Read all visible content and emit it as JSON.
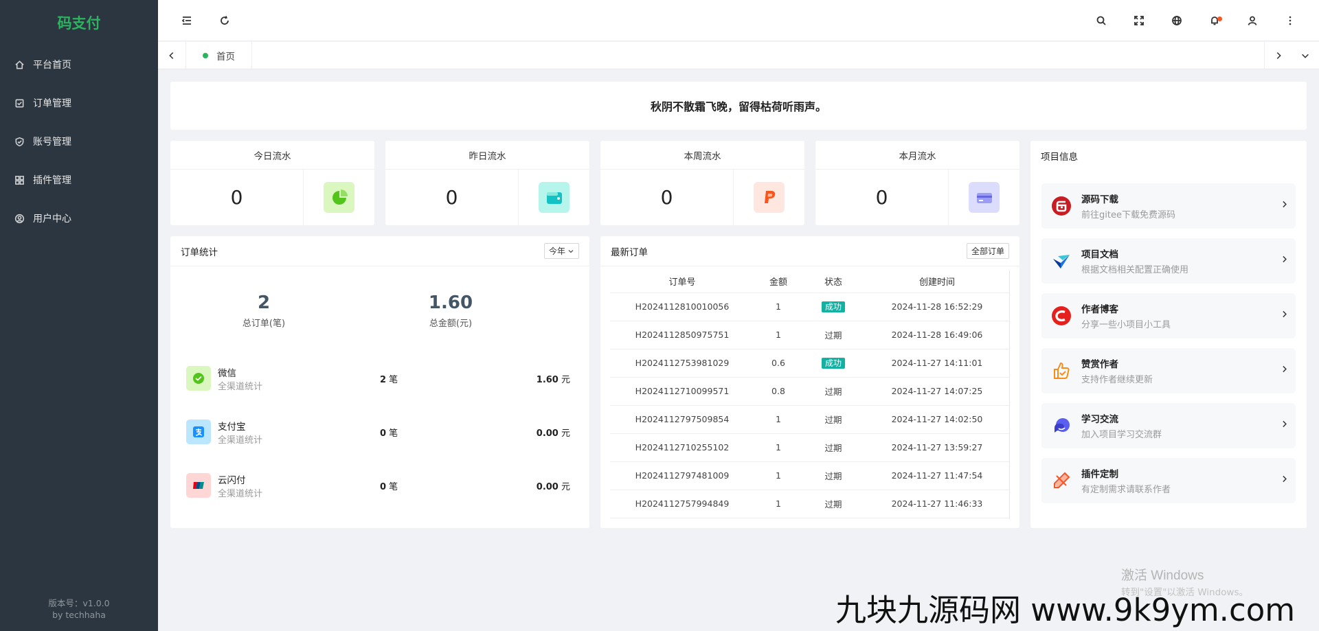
{
  "sidebar": {
    "brand": "码支付",
    "items": [
      {
        "label": "平台首页",
        "icon": "home-icon"
      },
      {
        "label": "订单管理",
        "icon": "checklist-icon"
      },
      {
        "label": "账号管理",
        "icon": "shield-check-icon"
      },
      {
        "label": "插件管理",
        "icon": "grid-icon"
      },
      {
        "label": "用户中心",
        "icon": "user-circle-icon"
      }
    ],
    "version": "版本号：v1.0.0",
    "author": "by techhaha"
  },
  "topbar": {
    "icons": [
      "menu-fold-icon",
      "refresh-icon",
      "search-icon",
      "fullscreen-icon",
      "globe-icon",
      "bell-icon",
      "user-icon",
      "more-icon"
    ]
  },
  "tabs": {
    "home_label": "首页"
  },
  "quote": "秋阴不散霜飞晚，留得枯荷听雨声。",
  "stats": [
    {
      "title": "今日流水",
      "value": "0",
      "icon": "pie-chart-icon",
      "color": "#52c41a"
    },
    {
      "title": "昨日流水",
      "value": "0",
      "icon": "wallet-icon",
      "color": "#13c2c2"
    },
    {
      "title": "本周流水",
      "value": "0",
      "icon": "paypal-icon",
      "color": "#fa541c"
    },
    {
      "title": "本月流水",
      "value": "0",
      "icon": "card-icon",
      "color": "#7c7ff0"
    }
  ],
  "order_stats": {
    "title": "订单统计",
    "range": "今年",
    "total_orders": "2",
    "total_orders_label": "总订单(笔)",
    "total_amount": "1.60",
    "total_amount_label": "总金额(元)",
    "channels": [
      {
        "name": "微信",
        "sub": "全渠道统计",
        "count": "2",
        "count_unit": " 笔",
        "amount": "1.60",
        "amount_unit": " 元",
        "icon": "wechat-icon"
      },
      {
        "name": "支付宝",
        "sub": "全渠道统计",
        "count": "0",
        "count_unit": " 笔",
        "amount": "0.00",
        "amount_unit": " 元",
        "icon": "alipay-icon"
      },
      {
        "name": "云闪付",
        "sub": "全渠道统计",
        "count": "0",
        "count_unit": " 笔",
        "amount": "0.00",
        "amount_unit": " 元",
        "icon": "unionpay-icon"
      }
    ]
  },
  "latest_orders": {
    "title": "最新订单",
    "all_button": "全部订单",
    "columns": [
      "订单号",
      "金额",
      "状态",
      "创建时间"
    ],
    "rows": [
      {
        "id": "H2024112810010056",
        "amount": "1",
        "status": "成功",
        "time": "2024-11-28 16:52:29",
        "ok": true
      },
      {
        "id": "H2024112850975751",
        "amount": "1",
        "status": "过期",
        "time": "2024-11-28 16:49:06",
        "ok": false
      },
      {
        "id": "H2024112753981029",
        "amount": "0.6",
        "status": "成功",
        "time": "2024-11-27 14:11:01",
        "ok": true
      },
      {
        "id": "H2024112710099571",
        "amount": "0.8",
        "status": "过期",
        "time": "2024-11-27 14:07:25",
        "ok": false
      },
      {
        "id": "H2024112797509854",
        "amount": "1",
        "status": "过期",
        "time": "2024-11-27 14:02:50",
        "ok": false
      },
      {
        "id": "H2024112710255102",
        "amount": "1",
        "status": "过期",
        "time": "2024-11-27 13:59:27",
        "ok": false
      },
      {
        "id": "H2024112797481009",
        "amount": "1",
        "status": "过期",
        "time": "2024-11-27 11:47:54",
        "ok": false
      },
      {
        "id": "H2024112757994849",
        "amount": "1",
        "status": "过期",
        "time": "2024-11-27 11:46:33",
        "ok": false
      }
    ]
  },
  "project_info": {
    "title": "项目信息",
    "items": [
      {
        "title": "源码下载",
        "sub": "前往gitee下载免费源码",
        "icon": "gitee-icon"
      },
      {
        "title": "项目文档",
        "sub": "根据文档相关配置正确使用",
        "icon": "docs-icon"
      },
      {
        "title": "作者博客",
        "sub": "分享一些小项目小工具",
        "icon": "csdn-icon"
      },
      {
        "title": "赞赏作者",
        "sub": "支持作者继续更新",
        "icon": "thumbs-up-icon"
      },
      {
        "title": "学习交流",
        "sub": "加入项目学习交流群",
        "icon": "chat-icon"
      },
      {
        "title": "插件定制",
        "sub": "有定制需求请联系作者",
        "icon": "pencil-ruler-icon"
      }
    ]
  },
  "watermarks": {
    "windows_title": "激活 Windows",
    "windows_sub": "转到\"设置\"以激活 Windows。",
    "site": "九块九源码网 www.9k9ym.com"
  }
}
